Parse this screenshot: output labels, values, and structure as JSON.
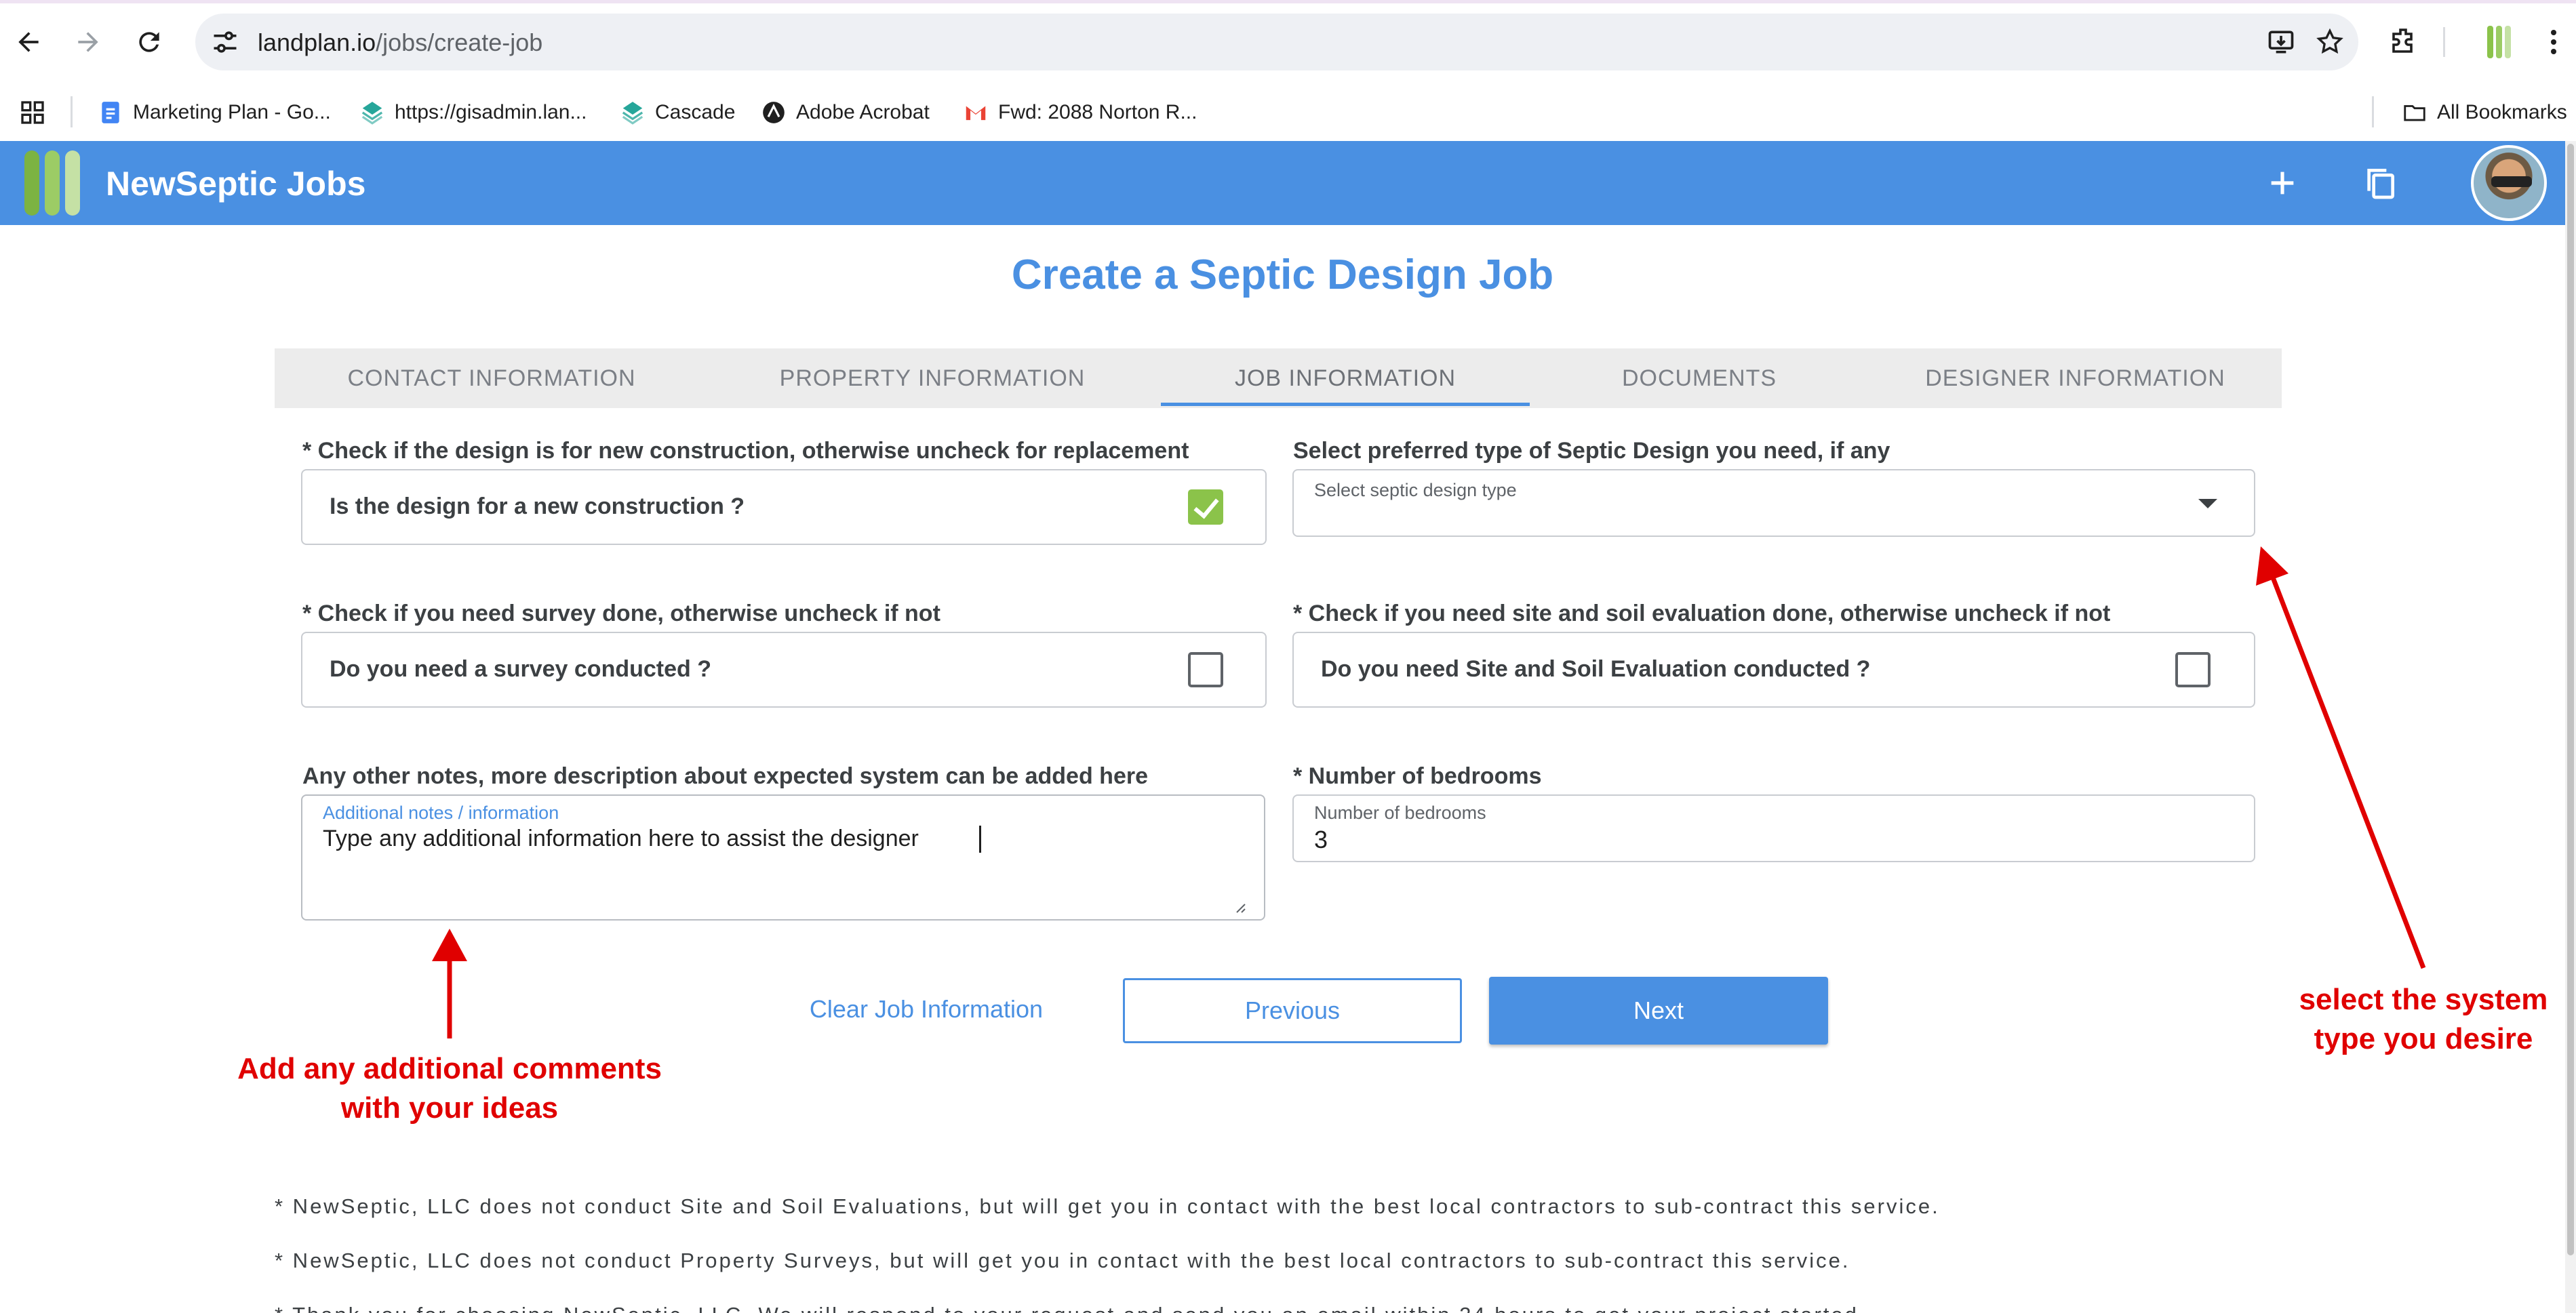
{
  "browser": {
    "url_host": "landplan.io",
    "url_path": "/jobs/create-job",
    "bookmarks": [
      {
        "label": "Marketing Plan - Go...",
        "icon": "google-docs-icon"
      },
      {
        "label": "https://gisadmin.lan...",
        "icon": "map-globe-icon"
      },
      {
        "label": "Cascade",
        "icon": "map-globe-icon"
      },
      {
        "label": "Adobe Acrobat",
        "icon": "acrobat-icon"
      },
      {
        "label": "Fwd: 2088 Norton R...",
        "icon": "gmail-icon"
      }
    ],
    "all_bookmarks_label": "All Bookmarks"
  },
  "app": {
    "title": "NewSeptic Jobs",
    "logo_colors": [
      "#8bc34a",
      "#9ccc65",
      "#aed581"
    ],
    "accent": "#4a90e2"
  },
  "page": {
    "title": "Create a Septic Design Job",
    "tabs": [
      {
        "label": "CONTACT INFORMATION"
      },
      {
        "label": "PROPERTY INFORMATION"
      },
      {
        "label": "JOB INFORMATION",
        "active": true
      },
      {
        "label": "DOCUMENTS"
      },
      {
        "label": "DESIGNER INFORMATION"
      }
    ]
  },
  "form": {
    "new_construction": {
      "label": "* Check if the design is for new construction, otherwise uncheck for replacement",
      "question": "Is the design for a new construction ?",
      "checked": true
    },
    "design_type": {
      "label": "Select preferred type of Septic Design you need, if any",
      "placeholder": "Select septic design type",
      "value": ""
    },
    "survey": {
      "label": "* Check if you need survey done, otherwise uncheck if not",
      "question": "Do you need a survey conducted ?",
      "checked": false
    },
    "site_soil": {
      "label": "* Check if you need site and soil evaluation done, otherwise uncheck if not",
      "question": "Do you need Site and Soil Evaluation conducted ?",
      "checked": false
    },
    "notes": {
      "label": "Any other notes, more description about expected system can be added here",
      "field_label": "Additional notes / information",
      "value": "Type any additional information here to assist the designer"
    },
    "bedrooms": {
      "label": "* Number of bedrooms",
      "field_label": "Number of bedrooms",
      "value": "3"
    }
  },
  "actions": {
    "clear": "Clear Job Information",
    "previous": "Previous",
    "next": "Next"
  },
  "annotations": {
    "notes_hint_line1": "Add any additional comments",
    "notes_hint_line2": "with your ideas",
    "type_hint_line1": "select the system",
    "type_hint_line2": "type you desire",
    "color": "#e00000"
  },
  "footnotes": [
    "* NewSeptic, LLC does not conduct Site and Soil Evaluations, but will get you in contact with the best local contractors to sub-contract this service.",
    "* NewSeptic, LLC does not conduct Property Surveys, but will get you in contact with the best local contractors to sub-contract this service.",
    "* Thank you for choosing NewSeptic, LLC. We will respond to your request and send you an email within 24 hours to get your project started."
  ]
}
